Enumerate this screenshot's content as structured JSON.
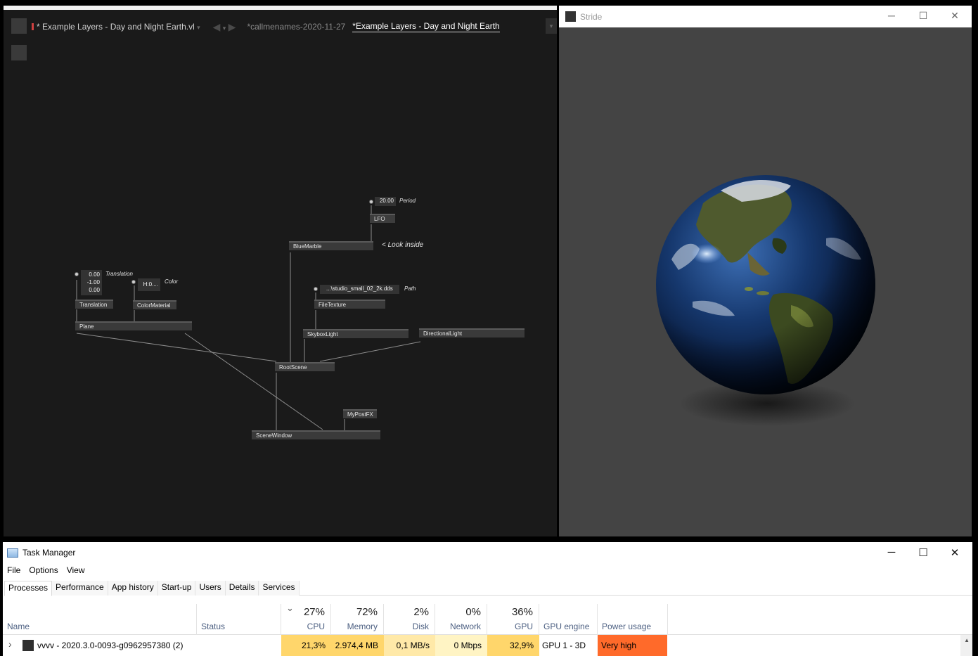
{
  "vvvv": {
    "tabs": {
      "doc_active": "Example Layers - Day and Night Earth.vl",
      "doc_active_dirty": "*",
      "nav_back": "◀",
      "nav_caret": "▾",
      "nav_forward": "▶",
      "tab1": "callmenames-2020-11-27",
      "tab1_dirty": "*",
      "tab2": "Example Layers - Day and Night Earth",
      "tab2_dirty": "*",
      "overflow": "▾"
    },
    "patch": {
      "iobox_period": "20.00",
      "label_period": "Period",
      "node_lfo": "LFO",
      "node_bluemarble": "BlueMarble",
      "comment_look_inside": "< Look inside",
      "iobox_translation": [
        "0.00",
        "-1.00",
        "0.00"
      ],
      "label_translation": "Translation",
      "iobox_color": "H:0....",
      "label_color": "Color",
      "iobox_path": "...\\studio_small_02_2k.dds",
      "label_path": "Path",
      "node_translation": "Translation",
      "node_colormaterial": "ColorMaterial",
      "node_filetexture": "FileTexture",
      "node_plane": "Plane",
      "node_skyboxlight": "SkyboxLight",
      "node_directionallight": "DirectionalLight",
      "node_rootscene": "RootScene",
      "node_mypostfx": "MyPostFX",
      "node_scenewindow": "SceneWindow"
    }
  },
  "stride": {
    "title": "Stride",
    "ctrl_min": "─",
    "ctrl_max": "☐",
    "ctrl_close": "✕",
    "background": "#444444"
  },
  "taskmanager": {
    "title": "Task Manager",
    "ctrl_min": "─",
    "ctrl_max": "☐",
    "ctrl_close": "✕",
    "menu": [
      "File",
      "Options",
      "View"
    ],
    "tabs": [
      "Processes",
      "Performance",
      "App history",
      "Start-up",
      "Users",
      "Details",
      "Services"
    ],
    "columns": {
      "name": "Name",
      "status": "Status",
      "cpu_pct": "27%",
      "cpu": "CPU",
      "mem_pct": "72%",
      "mem": "Memory",
      "disk_pct": "2%",
      "disk": "Disk",
      "net_pct": "0%",
      "net": "Network",
      "gpu_pct": "36%",
      "gpu": "GPU",
      "gpu_engine": "GPU engine",
      "power": "Power usage",
      "sort_caret": "⌄"
    },
    "row": {
      "expand": "›",
      "name": "vvvv - 2020.3.0-0093-g0962957380 (2)",
      "cpu": "21,3%",
      "mem": "2.974,4 MB",
      "disk": "0,1 MB/s",
      "net": "0 Mbps",
      "gpu": "32,9%",
      "gpu_engine": "GPU 1 - 3D",
      "power": "Very high"
    },
    "colors": {
      "heat_strong": "#ffd66b",
      "heat_mid": "#ffe9a8",
      "heat_light": "#fff4c4",
      "power_very_high": "#ff6a2a"
    }
  }
}
